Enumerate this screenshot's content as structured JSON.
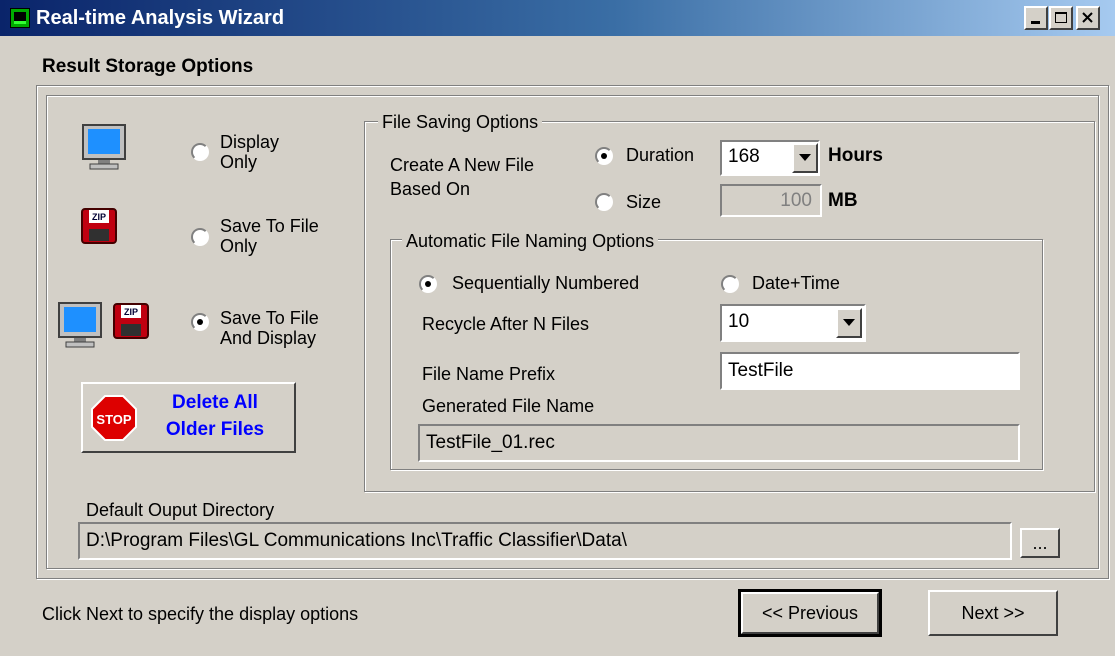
{
  "window": {
    "title": "Real-time Analysis Wizard"
  },
  "page": {
    "heading": "Result Storage Options",
    "footer_hint": "Click Next to specify the display options"
  },
  "storage_modes": [
    {
      "line1": "Display",
      "line2": "Only",
      "selected": false
    },
    {
      "line1": "Save To File",
      "line2": "Only",
      "selected": false
    },
    {
      "line1": "Save To File",
      "line2": "And Display",
      "selected": true
    }
  ],
  "delete_button": {
    "stop_label": "STOP",
    "line1": "Delete All",
    "line2": "Older Files"
  },
  "file_saving": {
    "legend": "File Saving Options",
    "create_label_line1": "Create A New File",
    "create_label_line2": "Based On",
    "duration_label": "Duration",
    "duration_selected": true,
    "duration_value": "168",
    "duration_unit": "Hours",
    "size_label": "Size",
    "size_selected": false,
    "size_value": "100",
    "size_unit": "MB"
  },
  "naming": {
    "legend": "Automatic File Naming Options",
    "sequential_label": "Sequentially Numbered",
    "sequential_selected": true,
    "datetime_label": "Date+Time",
    "datetime_selected": false,
    "recycle_label": "Recycle After N Files",
    "recycle_value": "10",
    "prefix_label": "File Name Prefix",
    "prefix_value": "TestFile",
    "generated_label": "Generated File Name",
    "generated_value": "TestFile_01.rec"
  },
  "output_dir": {
    "label": "Default Ouput Directory",
    "value": "D:\\Program Files\\GL Communications Inc\\Traffic Classifier\\Data\\",
    "browse_label": "..."
  },
  "nav": {
    "previous_label": "<< Previous",
    "next_label": "Next >>"
  },
  "colors": {
    "titlebar_start": "#0a246a",
    "titlebar_end": "#a6caf0",
    "face": "#d4d0c8",
    "link_blue": "#0000ff",
    "stop_red": "#cc0000"
  }
}
